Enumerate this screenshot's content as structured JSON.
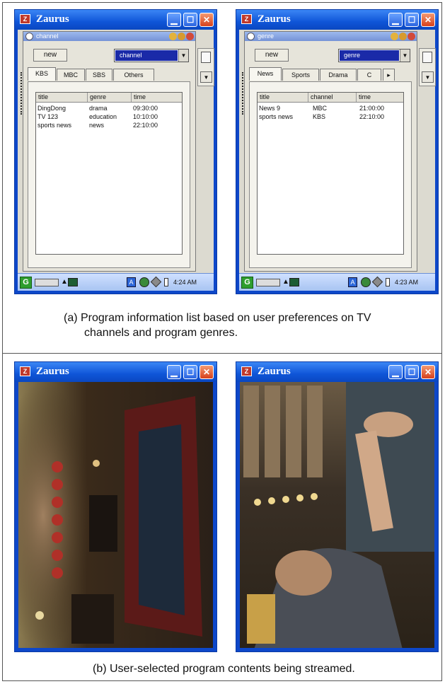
{
  "window_title": "Zaurus",
  "panel_a": {
    "caption_line1": "(a) Program information list based on user preferences on TV",
    "caption_line2": "channels and program genres.",
    "left": {
      "app_label": "channel",
      "new_button": "new",
      "combo_value": "channel",
      "tabs": [
        "KBS",
        "MBC",
        "SBS",
        "Others"
      ],
      "selected_tab": "KBS",
      "columns": [
        "title",
        "genre",
        "time"
      ],
      "rows": [
        [
          "DingDong",
          "drama",
          "09:30:00"
        ],
        [
          "TV 123",
          "education",
          "10:10:00"
        ],
        [
          "sports news",
          "news",
          "22:10:00"
        ]
      ],
      "clock": "4:24 AM"
    },
    "right": {
      "app_label": "genre",
      "new_button": "new",
      "combo_value": "genre",
      "tabs": [
        "News",
        "Sports",
        "Drama",
        "C"
      ],
      "selected_tab": "News",
      "columns": [
        "title",
        "channel",
        "time"
      ],
      "rows": [
        [
          "News 9",
          "MBC",
          "21:00:00"
        ],
        [
          "sports news",
          "KBS",
          "22:10:00"
        ]
      ],
      "clock": "4:23 AM"
    }
  },
  "panel_b": {
    "caption": "(b) User-selected program contents being streamed."
  },
  "icons": {
    "app": "zaurus-app-icon",
    "minimize": "minimize-icon",
    "maximize": "maximize-icon",
    "close": "close-icon",
    "copy": "clipboard-icon",
    "dropdown": "chevron-down-icon",
    "tab_scroll": "chevron-right-icon",
    "start": "start-icon",
    "keyboard": "keyboard-icon",
    "input_method": "input-method-icon",
    "network": "network-icon",
    "battery": "battery-icon"
  },
  "colors": {
    "titlebar": "#1558d6",
    "selection": "#1a2aa8",
    "close_button": "#d6411c",
    "taskbar": "#bcd2f8"
  }
}
